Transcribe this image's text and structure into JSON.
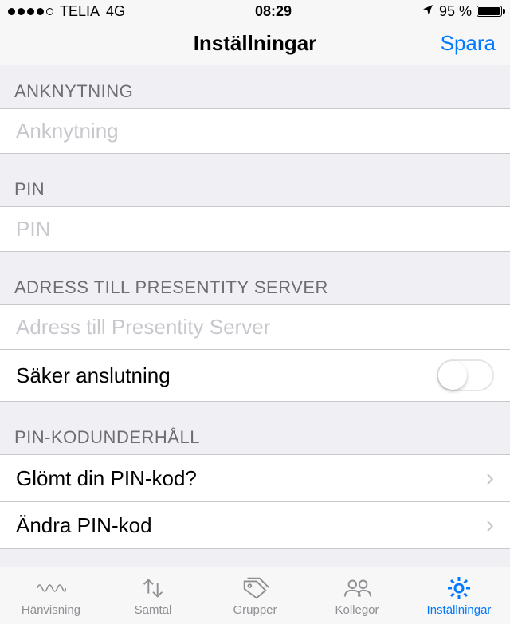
{
  "status_bar": {
    "carrier": "TELIA",
    "network": "4G",
    "time": "08:29",
    "battery_percent": "95 %"
  },
  "nav": {
    "title": "Inställningar",
    "save": "Spara"
  },
  "sections": {
    "extension": {
      "header": "ANKNYTNING",
      "placeholder": "Anknytning"
    },
    "pin": {
      "header": "PIN",
      "placeholder": "PIN"
    },
    "server": {
      "header": "ADRESS TILL PRESENTITY SERVER",
      "placeholder": "Adress till Presentity Server",
      "secure_label": "Säker anslutning"
    },
    "pin_maint": {
      "header": "PIN-KODUNDERHÅLL",
      "forgot": "Glömt din PIN-kod?",
      "change": "Ändra PIN-kod"
    }
  },
  "tabs": {
    "hanvisning": "Hänvisning",
    "samtal": "Samtal",
    "grupper": "Grupper",
    "kollegor": "Kollegor",
    "installningar": "Inställningar"
  }
}
